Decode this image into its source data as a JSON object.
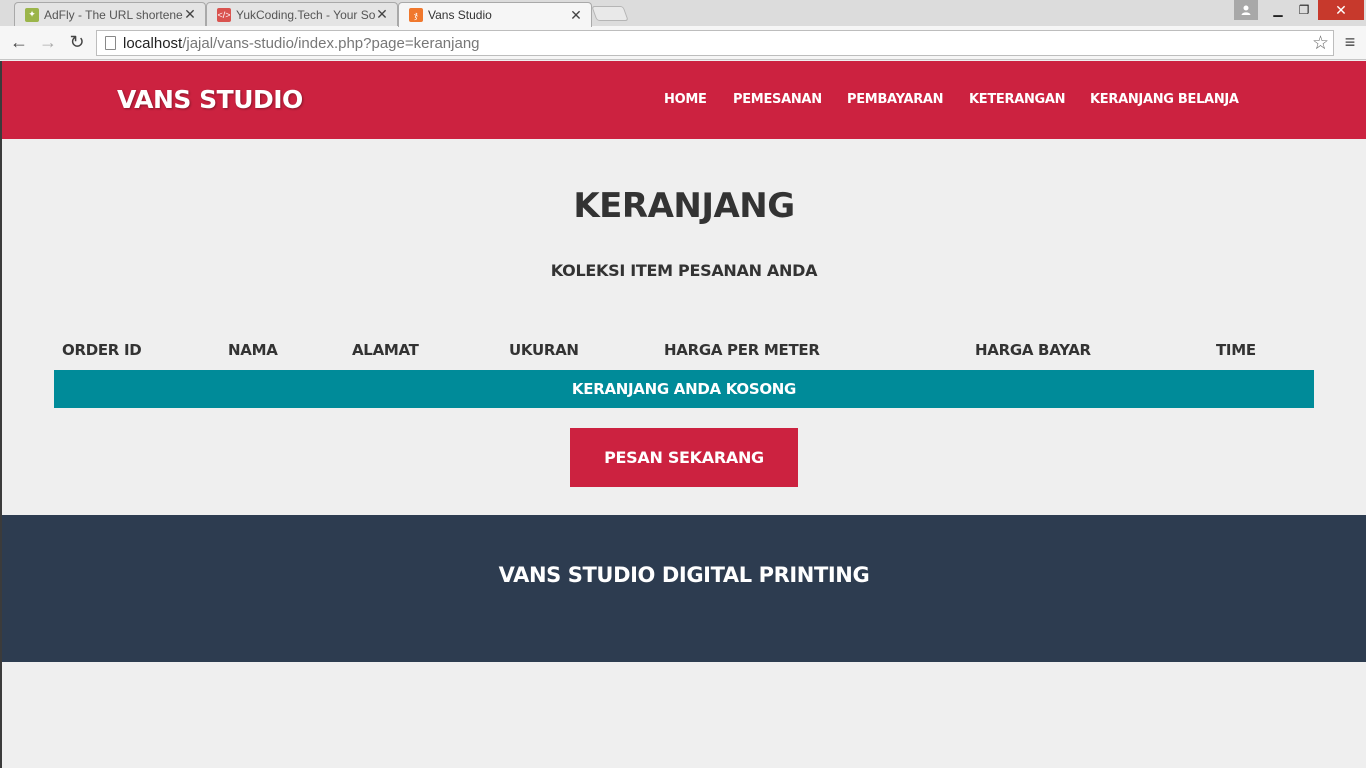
{
  "browser": {
    "tabs": [
      {
        "title": "AdFly - The URL shortener",
        "favicon": "adfly-icon",
        "active": false
      },
      {
        "title": "YukCoding.Tech - Your So",
        "favicon": "code-icon",
        "active": false
      },
      {
        "title": "Vans Studio",
        "favicon": "xampp-icon",
        "active": true
      }
    ],
    "url_host": "localhost",
    "url_path": "/jajal/vans-studio/index.php?page=keranjang"
  },
  "header": {
    "brand": "VANS STUDIO",
    "nav": [
      "HOME",
      "PEMESANAN",
      "PEMBAYARAN",
      "KETERANGAN",
      "KERANJANG BELANJA"
    ]
  },
  "main": {
    "title": "KERANJANG",
    "subtitle": "KOLEKSI ITEM PESANAN ANDA",
    "table_headers": [
      "ORDER ID",
      "NAMA",
      "ALAMAT",
      "UKURAN",
      "HARGA PER METER",
      "HARGA BAYAR",
      "TIME"
    ],
    "empty_message": "KERANJANG ANDA KOSONG",
    "order_button": "PESAN SEKARANG"
  },
  "footer": {
    "text": "VANS STUDIO DIGITAL PRINTING"
  },
  "colors": {
    "brand_red": "#cc2240",
    "teal": "#008b99",
    "footer_navy": "#2d3c50",
    "background": "#efefef"
  }
}
